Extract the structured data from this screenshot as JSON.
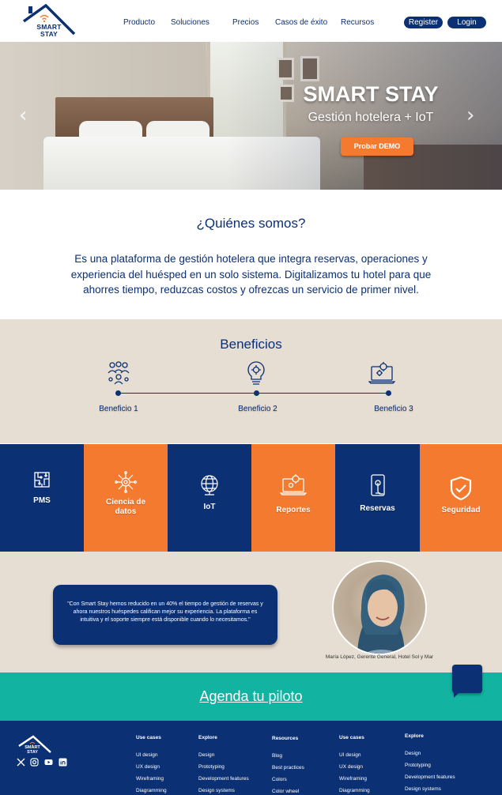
{
  "brand": {
    "logo_line1": "SMART",
    "logo_line2": "STAY"
  },
  "nav": {
    "items": [
      "Producto",
      "Soluciones",
      "Precios",
      "Casos de éxito",
      "Recursos"
    ],
    "register": "Register",
    "login": "Login"
  },
  "hero": {
    "title": "SMART STAY",
    "subtitle": "Gestión hotelera + IoT",
    "cta": "Probar DEMO",
    "prev_icon": "chevron-left-icon",
    "next_icon": "chevron-right-icon"
  },
  "about": {
    "title": "¿Quiénes somos?",
    "text": "Es una plataforma de gestión hotelera que integra reservas, operaciones y experiencia del huésped en un solo sistema. Digitalizamos tu hotel para que ahorres tiempo, reduzcas costos y ofrezcas un servicio de primer nivel."
  },
  "benefits": {
    "title": "Beneficios",
    "items": [
      {
        "label": "Beneficio 1",
        "icon": "team-icon"
      },
      {
        "label": "Beneficio 2",
        "icon": "lightbulb-gear-icon"
      },
      {
        "label": "Beneficio 3",
        "icon": "laptop-gear-icon"
      }
    ]
  },
  "features": [
    {
      "label": "PMS",
      "icon": "circuit-board-icon",
      "color": "#0b3074"
    },
    {
      "label": "Ciencia de datos",
      "icon": "data-science-icon",
      "color": "#f47a2f"
    },
    {
      "label": "IoT",
      "icon": "globe-network-icon",
      "color": "#0b3074"
    },
    {
      "label": "Reportes",
      "icon": "report-laptop-icon",
      "color": "#f47a2f"
    },
    {
      "label": "Reservas",
      "icon": "mobile-touch-icon",
      "color": "#0b3074"
    },
    {
      "label": "Seguridad",
      "icon": "shield-check-icon",
      "color": "#f47a2f"
    }
  ],
  "testimonial": {
    "quote": "\"Con Smart Stay hemos reducido en un 40% el tiempo de gestión de reservas y ahora nuestros huéspedes califican mejor su experiencia. La plataforma es intuitiva y el soporte siempre está disponible cuando lo necesitamos.\"",
    "author": "María López, Gerente General, Hotel Sol y Mar"
  },
  "cta": {
    "label": "Agenda tu piloto"
  },
  "footer": {
    "social": [
      "x-icon",
      "instagram-icon",
      "youtube-icon",
      "linkedin-icon"
    ],
    "columns": [
      {
        "heading": "Use cases",
        "items": [
          "UI design",
          "UX design",
          "Wireframing",
          "Diagramming"
        ]
      },
      {
        "heading": "Explore",
        "items": [
          "Design",
          "Prototyping",
          "Development features",
          "Design systems"
        ]
      },
      {
        "heading": "Resources",
        "items": [
          "Blog",
          "Best practices",
          "Colors",
          "Color wheel"
        ]
      },
      {
        "heading": "Use cases",
        "items": [
          "UI design",
          "UX design",
          "Wireframing",
          "Diagramming"
        ]
      },
      {
        "heading": "Explore",
        "items": [
          "Design",
          "Prototyping",
          "Development features",
          "Design systems"
        ]
      }
    ]
  },
  "colors": {
    "navy": "#0b3074",
    "orange": "#f47a2f",
    "teal": "#12b3a0",
    "beige": "#e6ddd3"
  }
}
